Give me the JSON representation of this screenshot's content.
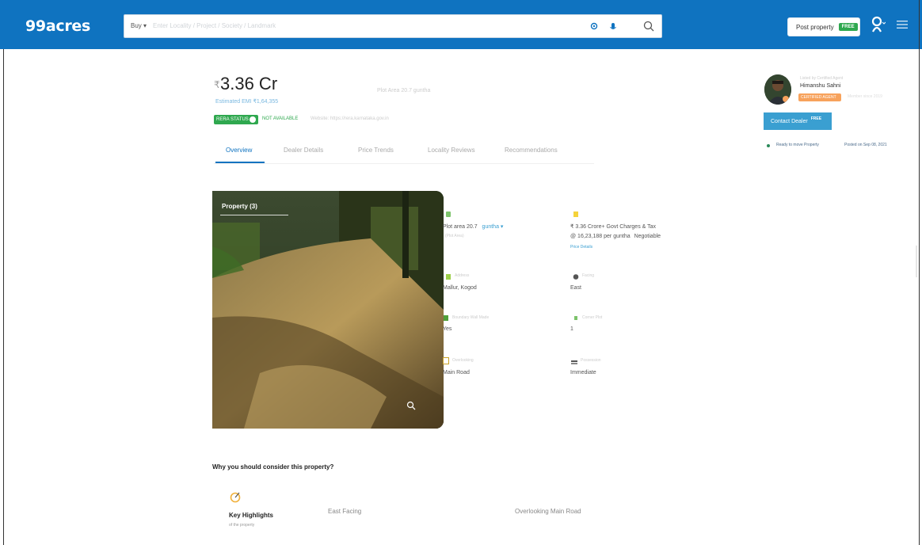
{
  "header": {
    "logo": "99acres",
    "search_mode": "Buy",
    "search_placeholder": "Enter Locality / Project / Society / Landmark",
    "post_property_label": "Post property",
    "post_property_badge": "FREE"
  },
  "listing": {
    "price": "3.36 Cr",
    "price_symbol": "₹",
    "estimate": "Estimated EMI ₹1,64,355",
    "price_aside": "Plot Area 20.7 guntha",
    "rera_badge": "RERA STATUS",
    "rera_status": "NOT AVAILABLE",
    "rera_note": "Website: https://rera.karnataka.gov.in"
  },
  "tabs": [
    {
      "label": "Overview"
    },
    {
      "label": "Dealer Details"
    },
    {
      "label": "Price Trends"
    },
    {
      "label": "Locality Reviews"
    },
    {
      "label": "Recommendations"
    }
  ],
  "dealer": {
    "caption": "Listed by Certified Agent",
    "name": "Himanshu Sahni",
    "badge": "CERTIFIED AGENT",
    "extra": "Member since 2019",
    "contact_label": "Contact Dealer",
    "contact_badge": "FREE",
    "ready_text": "Ready to move Property",
    "posted_text": "Posted on Sep 08, 2021"
  },
  "photo": {
    "label": "Property (3)"
  },
  "details": {
    "area_value": "Plot area 20.7",
    "area_unit": "guntha",
    "area_faint": "(Plot Area)",
    "price_line1": "₹ 3.36 Crore+ Govt Charges & Tax",
    "price_line2": "@ 16,23,188 per guntha",
    "price_line2_link": "Negotiable",
    "price_link": "Price Details",
    "address_faint": "Address",
    "address_value": "Mallur, Kogod",
    "facing_faint": "Facing",
    "facing_value": "East",
    "boundary_faint": "Boundary Wall Made",
    "boundary_value": "Yes",
    "plot_faint": "Corner Plot",
    "plot_value": "1",
    "overlooking_faint": "Overlooking",
    "overlooking_value": "Main Road",
    "possession_faint": "Possession",
    "possession_value": "Immediate"
  },
  "why": {
    "title": "Why you should consider this property?",
    "highlights_title": "Key Highlights",
    "highlights_sub": "of the property",
    "items": [
      "East Facing",
      "Overlooking Main Road"
    ]
  },
  "colors": {
    "brand": "#0f73c0",
    "accent": "#3a9fd1",
    "success": "#2fa84f",
    "badge": "#f7a25c"
  },
  "icons": {
    "location": "location-icon",
    "mic": "mic-icon",
    "search": "search-icon",
    "user": "user-icon",
    "menu": "hamburger-menu-icon",
    "zoom": "zoom-icon"
  }
}
